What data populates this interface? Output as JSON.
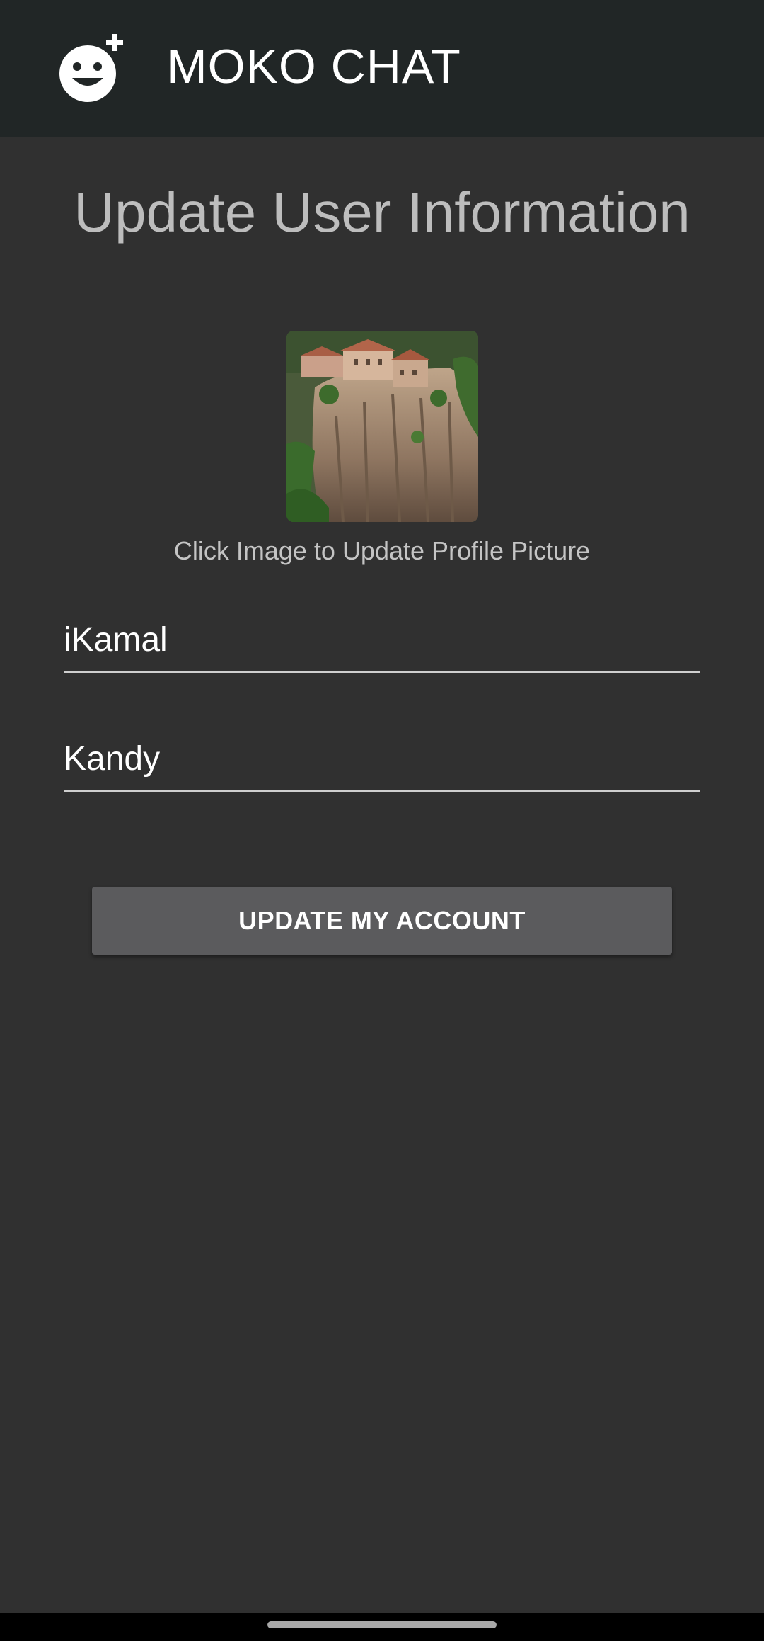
{
  "app_bar": {
    "title": "MOKO CHAT",
    "logo_icon": "smiley-plus-icon",
    "background": "#212626"
  },
  "page": {
    "title": "Update User Information",
    "background": "#303030"
  },
  "profile": {
    "picture_description": "photo of monastery on rocky cliff",
    "hint": "Click Image to Update Profile Picture"
  },
  "form": {
    "username_value": "iKamal",
    "location_value": "Kandy"
  },
  "actions": {
    "update_label": "UPDATE MY ACCOUNT",
    "button_color": "#5b5b5d"
  },
  "system": {
    "home_indicator_icon": "home-gesture-bar"
  }
}
